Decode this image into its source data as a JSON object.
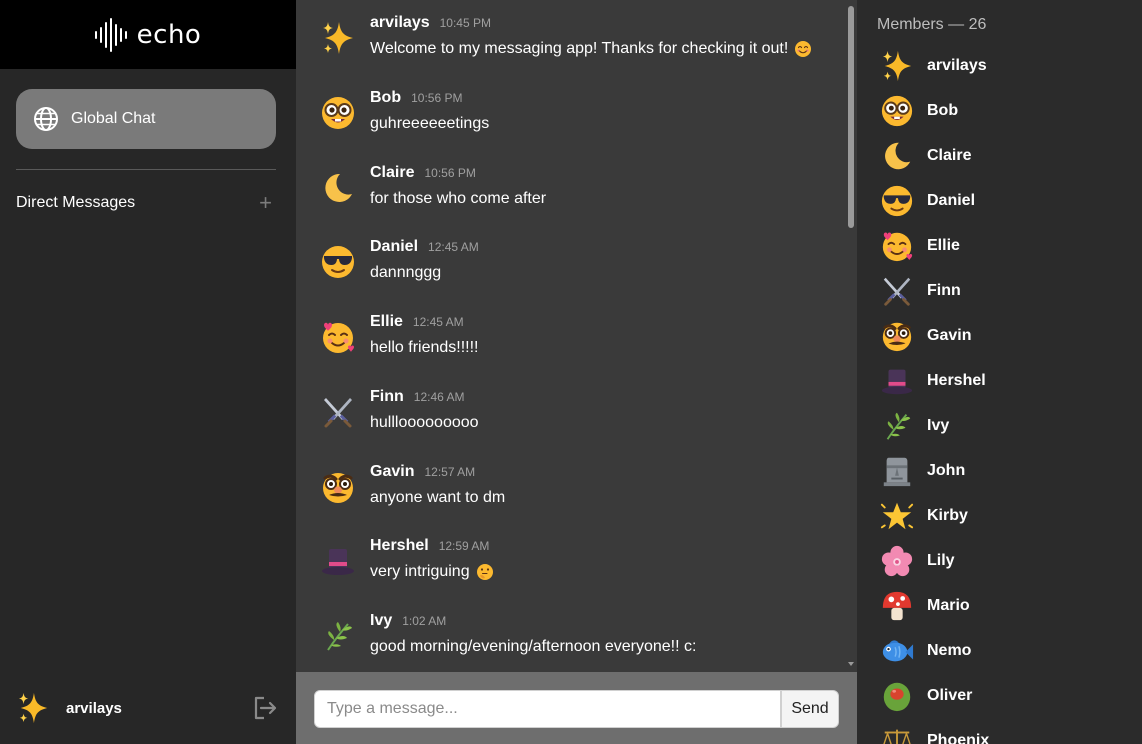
{
  "app": {
    "logo_text": "echo"
  },
  "sidebar": {
    "global_chat_label": "Global Chat",
    "direct_messages_label": "Direct Messages",
    "add_dm_symbol": "+",
    "current_user": "arvilays"
  },
  "messages": [
    {
      "author": "arvilays",
      "time": "10:45 PM",
      "text": "Welcome to my messaging app! Thanks for checking it out!",
      "avatar": "sparkles-icon",
      "inline_emoji": "smiling-face-icon"
    },
    {
      "author": "Bob",
      "time": "10:56 PM",
      "text": "guhreeeeeetings",
      "avatar": "nerd-face-icon"
    },
    {
      "author": "Claire",
      "time": "10:56 PM",
      "text": "for those who come after",
      "avatar": "crescent-moon-icon"
    },
    {
      "author": "Daniel",
      "time": "12:45 AM",
      "text": "dannnggg",
      "avatar": "sunglasses-face-icon"
    },
    {
      "author": "Ellie",
      "time": "12:45 AM",
      "text": "hello friends!!!!!",
      "avatar": "hearts-face-icon"
    },
    {
      "author": "Finn",
      "time": "12:46 AM",
      "text": "hulllooooooooo",
      "avatar": "crossed-swords-icon"
    },
    {
      "author": "Gavin",
      "time": "12:57 AM",
      "text": "anyone want to dm",
      "avatar": "disguise-face-icon"
    },
    {
      "author": "Hershel",
      "time": "12:59 AM",
      "text": "very intriguing",
      "avatar": "top-hat-icon",
      "inline_emoji": "thinking-face-icon"
    },
    {
      "author": "Ivy",
      "time": "1:02 AM",
      "text": "good morning/evening/afternoon everyone!! c:",
      "avatar": "herb-icon"
    }
  ],
  "composer": {
    "placeholder": "Type a message...",
    "send_label": "Send"
  },
  "members": {
    "title": "Members — 26",
    "list": [
      {
        "name": "arvilays",
        "avatar": "sparkles-icon"
      },
      {
        "name": "Bob",
        "avatar": "nerd-face-icon"
      },
      {
        "name": "Claire",
        "avatar": "crescent-moon-icon"
      },
      {
        "name": "Daniel",
        "avatar": "sunglasses-face-icon"
      },
      {
        "name": "Ellie",
        "avatar": "hearts-face-icon"
      },
      {
        "name": "Finn",
        "avatar": "crossed-swords-icon"
      },
      {
        "name": "Gavin",
        "avatar": "disguise-face-icon"
      },
      {
        "name": "Hershel",
        "avatar": "top-hat-icon"
      },
      {
        "name": "Ivy",
        "avatar": "herb-icon"
      },
      {
        "name": "John",
        "avatar": "moai-icon"
      },
      {
        "name": "Kirby",
        "avatar": "glowing-star-icon"
      },
      {
        "name": "Lily",
        "avatar": "cherry-blossom-icon"
      },
      {
        "name": "Mario",
        "avatar": "mushroom-icon"
      },
      {
        "name": "Nemo",
        "avatar": "fish-icon"
      },
      {
        "name": "Oliver",
        "avatar": "olive-icon"
      },
      {
        "name": "Phoenix",
        "avatar": "balance-scale-icon"
      }
    ]
  }
}
